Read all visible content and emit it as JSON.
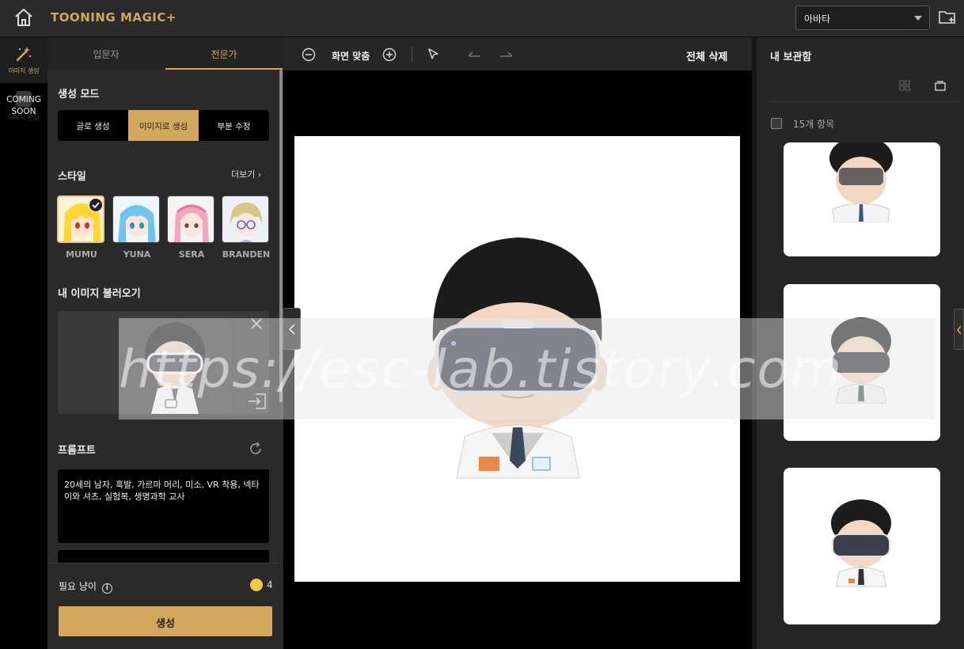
{
  "app": {
    "logo_text": "TOONING MAGIC+",
    "avatar_select": "아바타",
    "accent_color": "#d4a75e"
  },
  "rail": {
    "image_gen_label": "이미지 생성",
    "ghost_label": "이미지 편집",
    "coming_soon": [
      "COMING",
      "SOON"
    ]
  },
  "panel": {
    "tabs": [
      "입문자",
      "전문가"
    ],
    "active_tab": "전문가",
    "mode_title": "생성 모드",
    "modes": [
      "글로 생성",
      "이미지로 생성",
      "부분 수정"
    ],
    "active_mode": "이미지로 생성",
    "style_title": "스타일",
    "more_label": "더보기",
    "styles": [
      {
        "name": "MUMU",
        "selected": true
      },
      {
        "name": "YUNA",
        "selected": false
      },
      {
        "name": "SERA",
        "selected": false
      },
      {
        "name": "BRANDEN",
        "selected": false
      }
    ],
    "load_title": "내 이미지 불러오기",
    "prompt_title": "프롬프트",
    "prompt_text": "20세의 남자, 흑발, 가르마 머리, 미소, VR 착용, 넥타이와 셔츠, 실험복, 생명과학 교사",
    "need_label": "필요 냥이",
    "cost": "4",
    "generate_label": "생성"
  },
  "canvas_toolbar": {
    "fit_label": "화면 맞춤",
    "clear_all_label": "전체 삭제"
  },
  "watermark": "https://esc-lab.tistory.com",
  "right_panel": {
    "title": "내 보관함",
    "item_count": "15개 항목"
  }
}
